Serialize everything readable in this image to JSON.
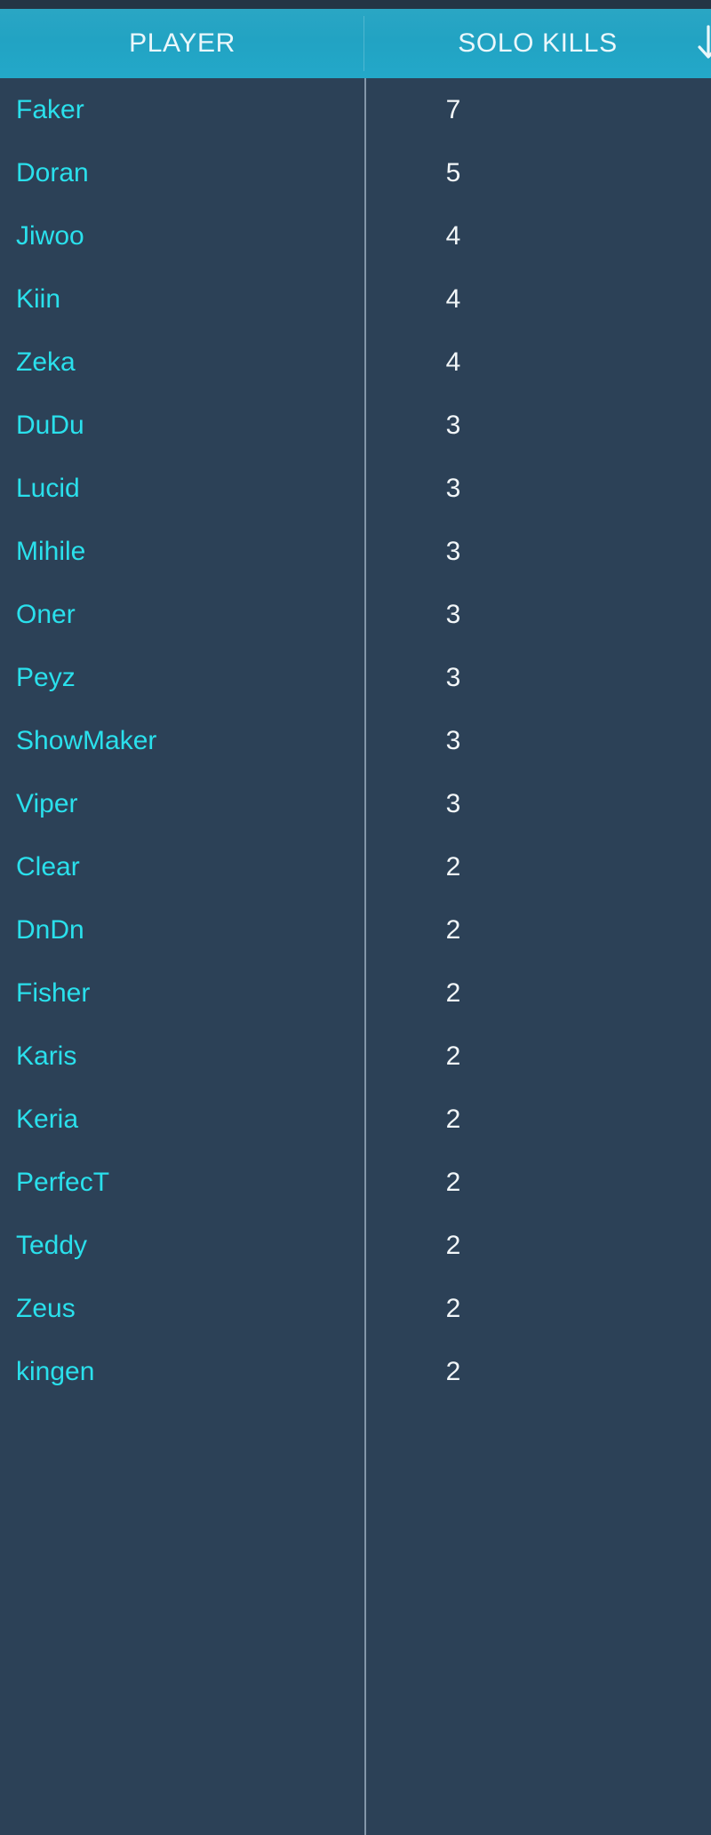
{
  "table": {
    "columns": [
      {
        "key": "player",
        "label": "PLAYER",
        "align": "left"
      },
      {
        "key": "solo_kills",
        "label": "SOLO KILLS",
        "align": "center"
      }
    ],
    "sort": {
      "column": "SOLO KILLS",
      "direction": "descending",
      "indicator_icon": "arrow-down-icon"
    },
    "rows": [
      {
        "player": "Faker",
        "solo_kills": "7"
      },
      {
        "player": "Doran",
        "solo_kills": "5"
      },
      {
        "player": "Jiwoo",
        "solo_kills": "4"
      },
      {
        "player": "Kiin",
        "solo_kills": "4"
      },
      {
        "player": "Zeka",
        "solo_kills": "4"
      },
      {
        "player": "DuDu",
        "solo_kills": "3"
      },
      {
        "player": "Lucid",
        "solo_kills": "3"
      },
      {
        "player": "Mihile",
        "solo_kills": "3"
      },
      {
        "player": "Oner",
        "solo_kills": "3"
      },
      {
        "player": "Peyz",
        "solo_kills": "3"
      },
      {
        "player": "ShowMaker",
        "solo_kills": "3"
      },
      {
        "player": "Viper",
        "solo_kills": "3"
      },
      {
        "player": "Clear",
        "solo_kills": "2"
      },
      {
        "player": "DnDn",
        "solo_kills": "2"
      },
      {
        "player": "Fisher",
        "solo_kills": "2"
      },
      {
        "player": "Karis",
        "solo_kills": "2"
      },
      {
        "player": "Keria",
        "solo_kills": "2"
      },
      {
        "player": "PerfecT",
        "solo_kills": "2"
      },
      {
        "player": "Teddy",
        "solo_kills": "2"
      },
      {
        "player": "Zeus",
        "solo_kills": "2"
      },
      {
        "player": "kingen",
        "solo_kills": "2"
      }
    ]
  },
  "theme": {
    "header_background": "#22a3c3",
    "header_text": "#eaf7fb",
    "body_background": "#2c4157",
    "player_text": "#2ae0ec",
    "value_text": "#f2f6f8",
    "divider": "#93a7b8",
    "top_strip": "#243545"
  }
}
